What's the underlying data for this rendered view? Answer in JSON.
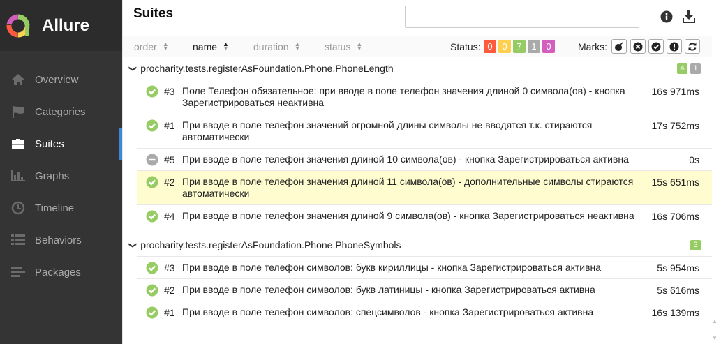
{
  "app": {
    "name": "Allure"
  },
  "nav": [
    {
      "label": "Overview",
      "icon": "home-icon",
      "active": false
    },
    {
      "label": "Categories",
      "icon": "flag-icon",
      "active": false
    },
    {
      "label": "Suites",
      "icon": "briefcase-icon",
      "active": true
    },
    {
      "label": "Graphs",
      "icon": "bar-chart-icon",
      "active": false
    },
    {
      "label": "Timeline",
      "icon": "clock-icon",
      "active": false
    },
    {
      "label": "Behaviors",
      "icon": "list-icon",
      "active": false
    },
    {
      "label": "Packages",
      "icon": "align-left-icon",
      "active": false
    }
  ],
  "pane": {
    "title": "Suites",
    "search_value": ""
  },
  "toolbar": {
    "sort": [
      {
        "label": "order",
        "active": false
      },
      {
        "label": "name",
        "active": true
      },
      {
        "label": "duration",
        "active": false
      },
      {
        "label": "status",
        "active": false
      }
    ],
    "status_label": "Status:",
    "statuses": [
      {
        "value": "0",
        "color": "#fd5a3e"
      },
      {
        "value": "0",
        "color": "#ffd050"
      },
      {
        "value": "7",
        "color": "#97cc64"
      },
      {
        "value": "1",
        "color": "#aaaaaa"
      },
      {
        "value": "0",
        "color": "#d35ebe"
      }
    ],
    "marks_label": "Marks:",
    "marks": [
      "bomb-icon",
      "x-circle-icon",
      "check-circle-icon",
      "exclamation-icon",
      "refresh-icon"
    ]
  },
  "colors": {
    "passed": "#97cc64",
    "skipped": "#aaaaaa",
    "highlight": "#fffdd0",
    "accent": "#3d88d7"
  },
  "groups": [
    {
      "name": "procharity.tests.registerAsFoundation.Phone.PhoneLength",
      "counts": [
        {
          "value": "4",
          "color": "#97cc64"
        },
        {
          "value": "1",
          "color": "#aaaaaa"
        }
      ],
      "rows": [
        {
          "order": "#3",
          "status": "passed",
          "name": "Поле Телефон обязательное: при вводе в поле телефон значения длиной 0 символа(ов) - кнопка Зарегистрироваться неактивна",
          "duration": "16s 971ms",
          "highlight": false
        },
        {
          "order": "#1",
          "status": "passed",
          "name": "При вводе в поле телефон значений огромной длины символы не вводятся т.к. стираются автоматически",
          "duration": "17s 752ms",
          "highlight": false
        },
        {
          "order": "#5",
          "status": "skipped",
          "name": "При вводе в поле телефон значения длиной 10 символа(ов) - кнопка Зарегистрироваться активна",
          "duration": "0s",
          "highlight": false
        },
        {
          "order": "#2",
          "status": "passed",
          "name": "При вводе в поле телефон значения длиной 11 символа(ов) - дополнительные символы стираются автоматически",
          "duration": "15s 651ms",
          "highlight": true
        },
        {
          "order": "#4",
          "status": "passed",
          "name": "При вводе в поле телефон значения длиной 9 символа(ов) - кнопка Зарегистрироваться неактивна",
          "duration": "16s 706ms",
          "highlight": false
        }
      ]
    },
    {
      "name": "procharity.tests.registerAsFoundation.Phone.PhoneSymbols",
      "counts": [
        {
          "value": "3",
          "color": "#97cc64"
        }
      ],
      "rows": [
        {
          "order": "#3",
          "status": "passed",
          "name": "При вводе в поле телефон символов: букв кириллицы - кнопка Зарегистрироваться активна",
          "duration": "5s 954ms",
          "highlight": false
        },
        {
          "order": "#2",
          "status": "passed",
          "name": "При вводе в поле телефон символов: букв латиницы - кнопка Зарегистрироваться активна",
          "duration": "5s 616ms",
          "highlight": false
        },
        {
          "order": "#1",
          "status": "passed",
          "name": "При вводе в поле телефон символов: спецсимволов - кнопка Зарегистрироваться активна",
          "duration": "16s 139ms",
          "highlight": false
        }
      ]
    }
  ]
}
